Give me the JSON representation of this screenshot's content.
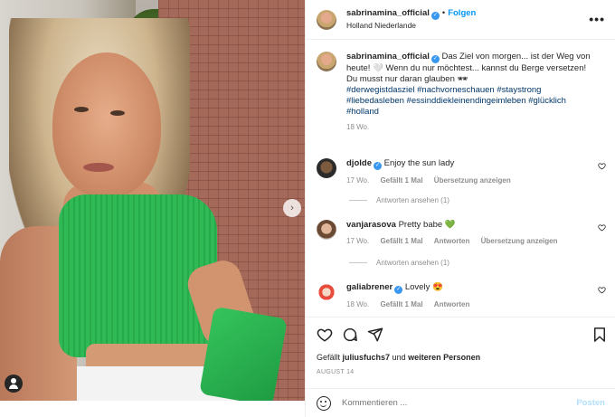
{
  "post": {
    "author": "sabrinamina_official",
    "follow_label": "Folgen",
    "separator": "•",
    "location": "Holland Niederlande",
    "more_label": "•••"
  },
  "caption": {
    "username": "sabrinamina_official",
    "text": "Das Ziel von morgen... ist der Weg von heute! 🤍 Wenn du nur möchtest... kannst du Berge versetzen! Du musst nur daran glauben 🕶",
    "hashtags": "#derwegistdasziel #nachvorneschauen #staystrong #liebedasleben #essinddiekleinendingeimleben #glücklich #holland",
    "age": "18 Wo."
  },
  "comments": [
    {
      "username": "djolde",
      "text": "Enjoy the sun lady",
      "age": "17 Wo.",
      "likes": "Gefällt 1 Mal",
      "translate": "Übersetzung anzeigen",
      "replies": "Antworten ansehen (1)"
    },
    {
      "username": "vanjarasova",
      "text": "Pretty babe 💚",
      "age": "17 Wo.",
      "likes": "Gefällt 1 Mal",
      "reply": "Antworten",
      "translate": "Übersetzung anzeigen",
      "replies": "Antworten ansehen (1)"
    },
    {
      "username": "galiabrener",
      "text": "Lovely 😍",
      "age": "18 Wo.",
      "likes": "Gefällt 1 Mal",
      "reply": "Antworten"
    }
  ],
  "actions": {
    "liked_by_prefix": "Gefällt",
    "liked_by_user": "juliusfuchs7",
    "liked_by_mid": "und",
    "liked_by_rest": "weiteren Personen",
    "date": "AUGUST 14"
  },
  "add_comment": {
    "placeholder": "Kommentieren ...",
    "post_label": "Posten"
  },
  "colors": {
    "accent": "#0095f6",
    "verified": "#3897f0",
    "hashtag": "#00376b",
    "muted": "#8e8e8e"
  },
  "icons": [
    "next-chevron-icon",
    "user-tag-icon",
    "verified-badge-icon",
    "heart-icon",
    "comment-icon",
    "share-icon",
    "bookmark-icon",
    "emoji-icon",
    "more-options-icon"
  ]
}
